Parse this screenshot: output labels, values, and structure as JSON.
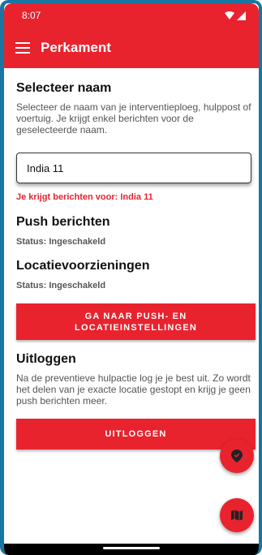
{
  "status_bar": {
    "time": "8:07"
  },
  "app_bar": {
    "title": "Perkament"
  },
  "select_name": {
    "heading": "Selecteer naam",
    "description": "Selecteer de naam van je interventieploeg, hulppost of voertuig. Je krijgt enkel berichten voor de geselecteerde naam.",
    "selected_value": "India 11",
    "notice": "Je krijgt berichten voor: India 11"
  },
  "push": {
    "heading": "Push berichten",
    "status": "Status: Ingeschakeld"
  },
  "location": {
    "heading": "Locatievoorzieningen",
    "status": "Status: Ingeschakeld"
  },
  "settings_button": {
    "label": "GA NAAR PUSH- EN LOCATIEINSTELLINGEN"
  },
  "logout": {
    "heading": "Uitloggen",
    "description": "Na de preventieve hulpactie log je je best uit. Zo wordt het delen van je exacte locatie gestopt en krijg je geen push berichten meer.",
    "button_label": "UITLOGGEN"
  },
  "fabs": {
    "location_icon": "location-pin-icon",
    "map_icon": "map-icon"
  },
  "colors": {
    "primary": "#e8232e",
    "frame": "#1976a3"
  }
}
